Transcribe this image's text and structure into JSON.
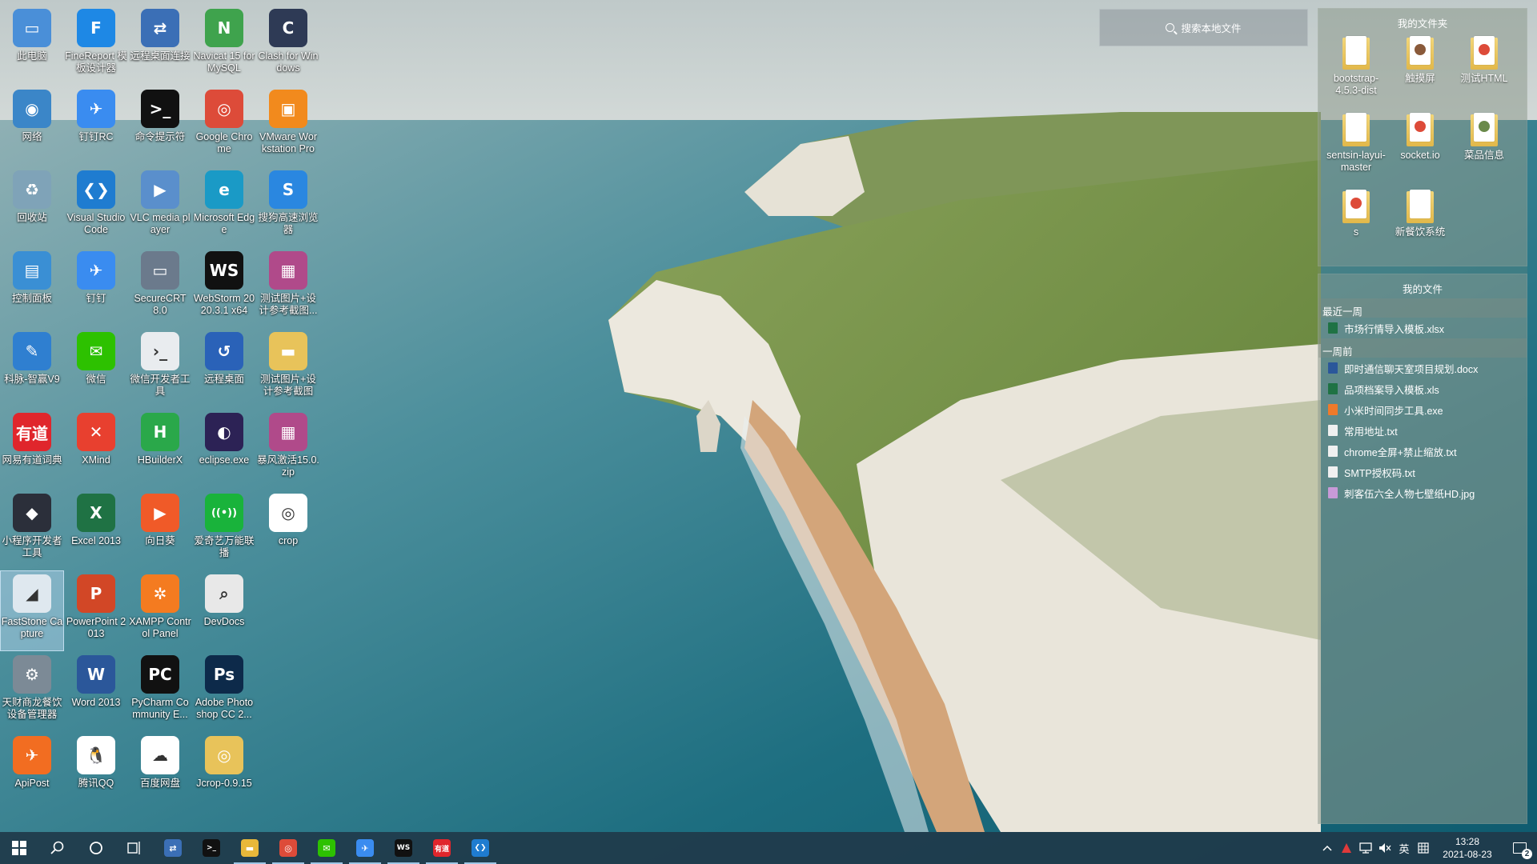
{
  "desktop": {
    "icons": [
      {
        "label": "此电脑",
        "icon": "computer-icon",
        "color": "#4a8fd8",
        "glyph": "▭",
        "selected": false
      },
      {
        "label": "FineReport 模板设计器",
        "icon": "finereport-icon",
        "color": "#1e88e5",
        "glyph": "F",
        "selected": false
      },
      {
        "label": "远程桌面连接",
        "icon": "remote-desktop-connection-icon",
        "color": "#3b6fb6",
        "glyph": "⇄",
        "selected": false
      },
      {
        "label": "Navicat 15 for MySQL",
        "icon": "navicat-icon",
        "color": "#3fa34d",
        "glyph": "N",
        "selected": false
      },
      {
        "label": "Clash for Windows",
        "icon": "clash-icon",
        "color": "#2e3a55",
        "glyph": "C",
        "selected": false
      },
      {
        "label": "网络",
        "icon": "network-icon",
        "color": "#3b86c8",
        "glyph": "◉",
        "selected": false
      },
      {
        "label": "钉钉RC",
        "icon": "dingtalk-rc-icon",
        "color": "#3a8cf0",
        "glyph": "✈",
        "selected": false
      },
      {
        "label": "命令提示符",
        "icon": "cmd-icon",
        "color": "#111111",
        "glyph": ">_",
        "selected": false
      },
      {
        "label": "Google Chrome",
        "icon": "chrome-icon",
        "color": "#dd4b39",
        "glyph": "◎",
        "selected": false
      },
      {
        "label": "VMware Workstation Pro",
        "icon": "vmware-icon",
        "color": "#f28a1d",
        "glyph": "▣",
        "selected": false
      },
      {
        "label": "回收站",
        "icon": "recycle-bin-icon",
        "color": "#7fa3b8",
        "glyph": "♻",
        "selected": false
      },
      {
        "label": "Visual Studio Code",
        "icon": "vscode-icon",
        "color": "#1f7cd0",
        "glyph": "❮❯",
        "selected": false
      },
      {
        "label": "VLC media player",
        "icon": "vlc-icon",
        "color": "#5a8fcc",
        "glyph": "▶",
        "selected": false
      },
      {
        "label": "Microsoft Edge",
        "icon": "edge-icon",
        "color": "#1a9ac6",
        "glyph": "e",
        "selected": false
      },
      {
        "label": "搜狗高速浏览器",
        "icon": "sogou-browser-icon",
        "color": "#2a87e0",
        "glyph": "S",
        "selected": false
      },
      {
        "label": "控制面板",
        "icon": "control-panel-icon",
        "color": "#3a8fd4",
        "glyph": "▤",
        "selected": false
      },
      {
        "label": "钉钉",
        "icon": "dingtalk-icon",
        "color": "#3a8cf0",
        "glyph": "✈",
        "selected": false
      },
      {
        "label": "SecureCRT 8.0",
        "icon": "securecrt-icon",
        "color": "#6b7a8c",
        "glyph": "▭",
        "selected": false
      },
      {
        "label": "WebStorm 2020.3.1 x64",
        "icon": "webstorm-icon",
        "color": "#111111",
        "glyph": "WS",
        "selected": false
      },
      {
        "label": "测试图片+设计参考截图...",
        "icon": "winrar-icon",
        "color": "#b04a8a",
        "glyph": "▦",
        "selected": false
      },
      {
        "label": "科脉-智赢V9",
        "icon": "kemai-icon",
        "color": "#2f7fd0",
        "glyph": "✎",
        "selected": false
      },
      {
        "label": "微信",
        "icon": "wechat-icon",
        "color": "#2dc100",
        "glyph": "✉",
        "selected": false
      },
      {
        "label": "微信开发者工具",
        "icon": "wechat-devtools-icon",
        "color": "#e9ecef",
        "glyph": "›_",
        "selected": false
      },
      {
        "label": "远程桌面",
        "icon": "remote-desktop-icon",
        "color": "#2a62b8",
        "glyph": "↺",
        "selected": false
      },
      {
        "label": "测试图片+设计参考截图",
        "icon": "folder-icon",
        "color": "#e8c35a",
        "glyph": "▬",
        "selected": false
      },
      {
        "label": "网易有道词典",
        "icon": "youdao-icon",
        "color": "#e0262c",
        "glyph": "有道",
        "selected": false
      },
      {
        "label": "XMind",
        "icon": "xmind-icon",
        "color": "#e8402f",
        "glyph": "✕",
        "selected": false
      },
      {
        "label": "HBuilderX",
        "icon": "hbuilderx-icon",
        "color": "#2aa84a",
        "glyph": "H",
        "selected": false
      },
      {
        "label": "eclipse.exe",
        "icon": "eclipse-icon",
        "color": "#2c2255",
        "glyph": "◐",
        "selected": false
      },
      {
        "label": "暴风激活15.0.zip",
        "icon": "winrar-icon",
        "color": "#b04a8a",
        "glyph": "▦",
        "selected": false
      },
      {
        "label": "小程序开发者工具",
        "icon": "miniprogram-devtools-icon",
        "color": "#2b2f3a",
        "glyph": "◆",
        "selected": false
      },
      {
        "label": "Excel 2013",
        "icon": "excel-icon",
        "color": "#1f7244",
        "glyph": "X",
        "selected": false
      },
      {
        "label": "向日葵",
        "icon": "sunlogin-icon",
        "color": "#f05a28",
        "glyph": "▶",
        "selected": false
      },
      {
        "label": "爱奇艺万能联播",
        "icon": "iqiyi-icon",
        "color": "#19b33b",
        "glyph": "((•))",
        "selected": false
      },
      {
        "label": "crop",
        "icon": "crop-file-icon",
        "color": "#ffffff",
        "glyph": "◎",
        "selected": false
      },
      {
        "label": "FastStone Capture",
        "icon": "faststone-icon",
        "color": "#dfe8ef",
        "glyph": "◢",
        "selected": true
      },
      {
        "label": "PowerPoint 2013",
        "icon": "powerpoint-icon",
        "color": "#d24726",
        "glyph": "P",
        "selected": false
      },
      {
        "label": "XAMPP Control Panel",
        "icon": "xampp-icon",
        "color": "#f47b20",
        "glyph": "✲",
        "selected": false
      },
      {
        "label": "DevDocs",
        "icon": "devdocs-icon",
        "color": "#e8e8e8",
        "glyph": "⌕",
        "selected": false
      },
      {
        "label": "",
        "icon": "empty-slot",
        "color": "",
        "glyph": "",
        "selected": false
      },
      {
        "label": "天财商龙餐饮设备管理器",
        "icon": "tiancai-gear-icon",
        "color": "#7c8a96",
        "glyph": "⚙",
        "selected": false
      },
      {
        "label": "Word 2013",
        "icon": "word-icon",
        "color": "#2b579a",
        "glyph": "W",
        "selected": false
      },
      {
        "label": "PyCharm Community E...",
        "icon": "pycharm-icon",
        "color": "#111111",
        "glyph": "PC",
        "selected": false
      },
      {
        "label": "Adobe Photoshop CC 2...",
        "icon": "photoshop-icon",
        "color": "#0d2a4a",
        "glyph": "Ps",
        "selected": false
      },
      {
        "label": "",
        "icon": "empty-slot",
        "color": "",
        "glyph": "",
        "selected": false
      },
      {
        "label": "ApiPost",
        "icon": "apipost-icon",
        "color": "#f26d21",
        "glyph": "✈",
        "selected": false
      },
      {
        "label": "腾讯QQ",
        "icon": "qq-icon",
        "color": "#ffffff",
        "glyph": "🐧",
        "selected": false
      },
      {
        "label": "百度网盘",
        "icon": "baidu-netdisk-icon",
        "color": "#ffffff",
        "glyph": "☁",
        "selected": false
      },
      {
        "label": "Jcrop-0.9.15",
        "icon": "jcrop-file-icon",
        "color": "#e8c35a",
        "glyph": "◎",
        "selected": false
      }
    ]
  },
  "search": {
    "placeholder": "搜索本地文件"
  },
  "panel": {
    "folders_title": "我的文件夹",
    "folders": [
      {
        "label": "bootstrap-4.5.3-dist",
        "badge": ""
      },
      {
        "label": "触摸屏",
        "badge": "#8a5a3a"
      },
      {
        "label": "测试HTML",
        "badge": "#dd4b39"
      },
      {
        "label": "sentsin-layui-master",
        "badge": ""
      },
      {
        "label": "socket.io",
        "badge": "#dd4b39"
      },
      {
        "label": "菜品信息",
        "badge": "#6a8a4a"
      },
      {
        "label": "s",
        "badge": "#dd4b39"
      },
      {
        "label": "新餐饮系统",
        "badge": ""
      }
    ],
    "files_title": "我的文件",
    "groups": [
      {
        "header": "最近一周",
        "files": [
          {
            "name": "市场行情导入模板.xlsx",
            "color": "#1f7244"
          }
        ]
      },
      {
        "header": "一周前",
        "files": [
          {
            "name": "即时通信聊天室项目规划.docx",
            "color": "#2b579a"
          },
          {
            "name": "品项档案导入模板.xls",
            "color": "#1f7244"
          },
          {
            "name": "小米时间同步工具.exe",
            "color": "#f07a2a"
          },
          {
            "name": "常用地址.txt",
            "color": "#f0f0f0"
          },
          {
            "name": "chrome全屏+禁止缩放.txt",
            "color": "#f0f0f0"
          },
          {
            "name": "SMTP授权码.txt",
            "color": "#f0f0f0"
          },
          {
            "name": "刺客伍六全人物七壁纸HD.jpg",
            "color": "#c89ad8"
          }
        ]
      }
    ]
  },
  "taskbar": {
    "apps": [
      {
        "name": "remote-desktop-connection",
        "icon": "remote-desktop-connection-icon",
        "color": "#3b6fb6",
        "glyph": "⇄",
        "running": false
      },
      {
        "name": "cmd",
        "icon": "cmd-icon",
        "color": "#111111",
        "glyph": ">_",
        "running": false
      },
      {
        "name": "file-explorer",
        "icon": "file-explorer-icon",
        "color": "#e8b83a",
        "glyph": "▬",
        "running": true
      },
      {
        "name": "chrome",
        "icon": "chrome-icon",
        "color": "#dd4b39",
        "glyph": "◎",
        "running": true
      },
      {
        "name": "wechat",
        "icon": "wechat-icon",
        "color": "#2dc100",
        "glyph": "✉",
        "running": true
      },
      {
        "name": "dingtalk",
        "icon": "dingtalk-icon",
        "color": "#3a8cf0",
        "glyph": "✈",
        "running": true
      },
      {
        "name": "webstorm",
        "icon": "webstorm-icon",
        "color": "#111111",
        "glyph": "WS",
        "running": true
      },
      {
        "name": "youdao",
        "icon": "youdao-icon",
        "color": "#e0262c",
        "glyph": "有道",
        "running": true
      },
      {
        "name": "vscode",
        "icon": "vscode-icon",
        "color": "#1f7cd0",
        "glyph": "❮❯",
        "running": true
      }
    ],
    "tray": {
      "ime": "英",
      "time": "13:28",
      "date": "2021-08-23",
      "notification_count": "2"
    }
  }
}
